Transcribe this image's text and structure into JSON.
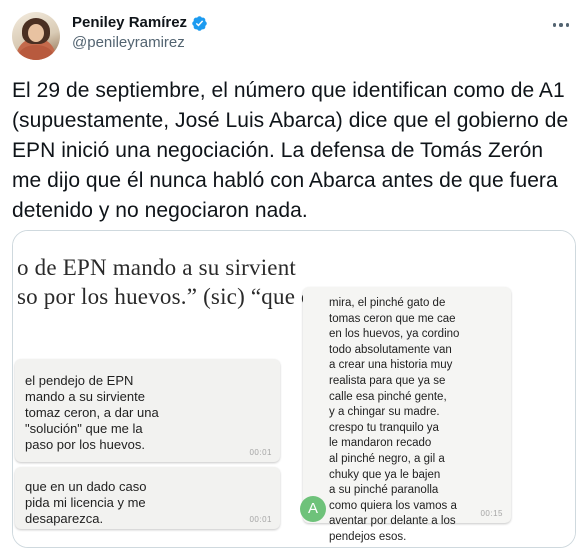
{
  "author": {
    "display_name": "Peniley Ramírez",
    "handle": "@penileyramirez",
    "verified": true
  },
  "tweet": {
    "text": "El 29 de septiembre, el número que identifican como de A1 (supuestamente, José Luis Abarca) dice que el gobierno de EPN inició una negociación. La defensa de Tomás Zerón me dijo que él nunca habló con Abarca antes de que fuera detenido y no negociaron nada."
  },
  "media": {
    "print_lines": [
      "o de EPN mando a su sirvient",
      "so por los huevos.” (sic) “que c"
    ],
    "chat_left": [
      {
        "text": "el pendejo de EPN\nmando a su sirviente\ntomaz ceron, a dar una\n\"solución\" que me la\npaso por los huevos.",
        "time": "00:01"
      },
      {
        "text": "que en un dado caso\npida mi licencia y me\ndesaparezca.",
        "time": "00:01"
      }
    ],
    "chat_right": {
      "text": "mira, el pinché gato de\ntomas ceron que me cae\nen los huevos, ya cordino\ntodo absolutamente van\na crear una historia muy\nrealista para que ya se\ncalle esa pinché gente,\ny a chingar su madre.\ncrespo tu tranquilo ya\nle mandaron recado\nal pinché negro, a gil a\nchuky que ya le bajen\na su pinché paranolla\ncomo quiera los vamos a\naventar por delante a los\npendejos esos.",
      "time": "00:15",
      "sender_initial": "A"
    }
  },
  "colors": {
    "verified_blue": "#1d9bf0",
    "handle_gray": "#536471",
    "badge_green": "#6ec27a"
  },
  "icons": [
    "verified-badge-icon",
    "more-options-icon"
  ]
}
